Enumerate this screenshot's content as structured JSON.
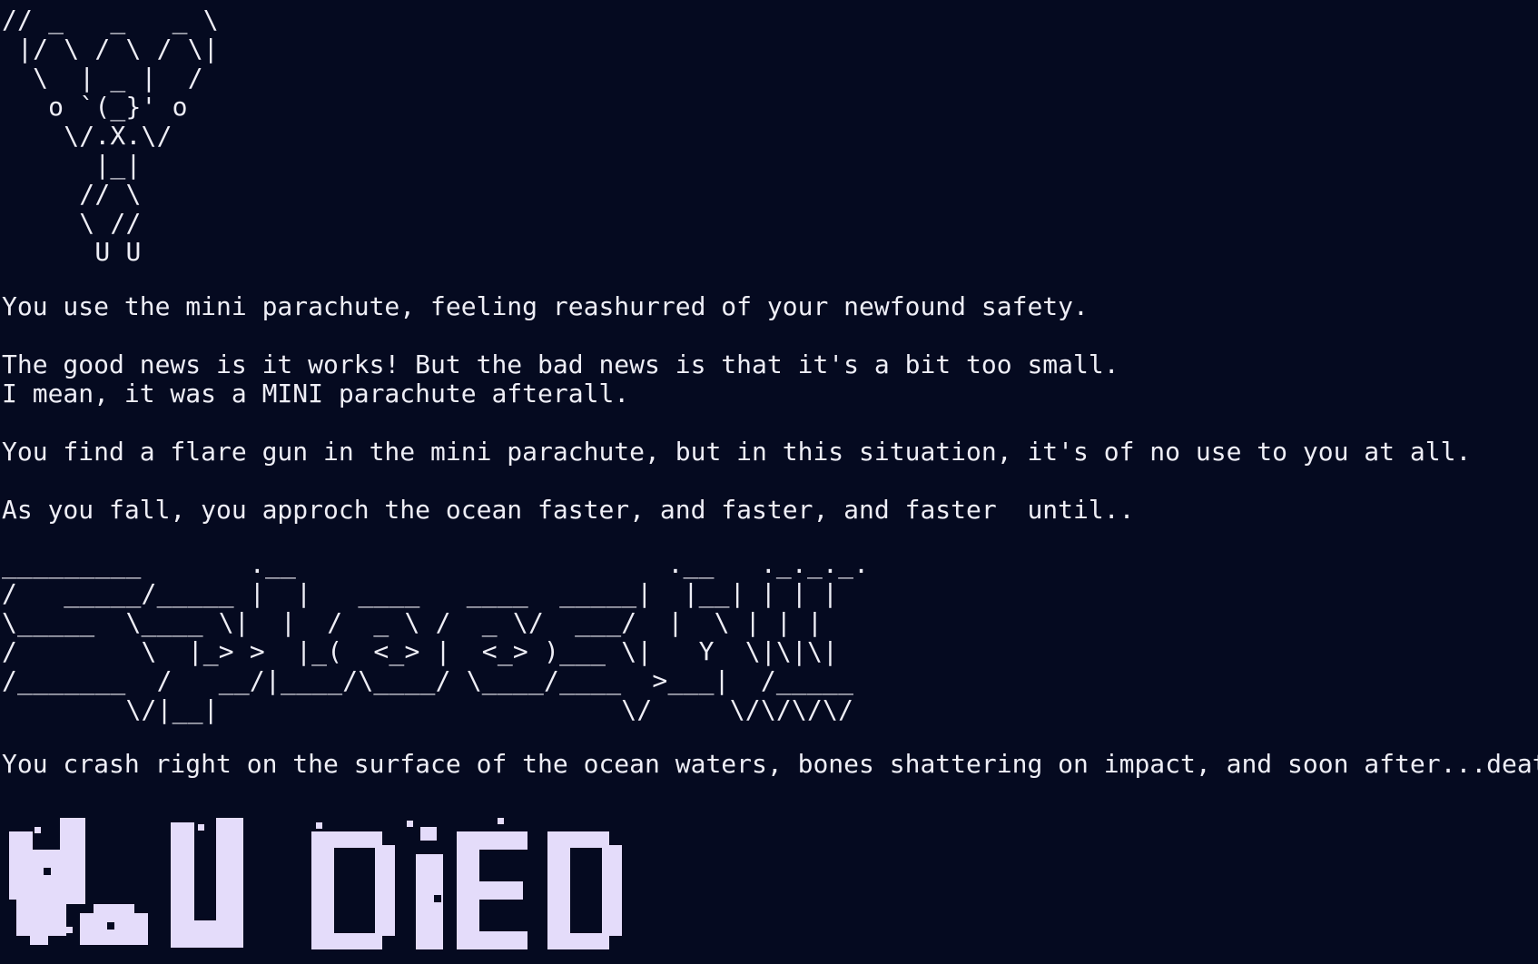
{
  "terminal": {
    "background": "#050a20",
    "foreground": "#eeeef6",
    "banner_color": "#e4dcfa",
    "deer_art": [
      "// _   _   _ \\",
      " |/ \\ / \\ / \\|",
      "  \\  | _ |  /",
      "   o `(_}' o",
      "    \\/.X.\\/",
      "      |_|",
      "     // \\",
      "     \\ //",
      "      U U"
    ],
    "story": [
      "You use the mini parachute, feeling reashurred of your newfound safety.",
      "",
      "The good news is it works! But the bad news is that it's a bit too small.",
      "I mean, it was a MINI parachute afterall.",
      "",
      "You find a flare gun in the mini parachute, but in this situation, it's of no use to you at all.",
      "",
      "As you fall, you approch the ocean faster, and faster, and faster  until.."
    ],
    "splash_art": [
      "_________       .__                        .__   ._._._.",
      "/   _____/_____ |  |   ____   ____  _____|  |__| | | |",
      "\\_____  \\____ \\|  |  /  _ \\ /  _ \\/  ___/  |  \\ | | |",
      "/        \\  |_> >  |_(  <_> |  <_> )___ \\|   Y  \\|\\|\\|",
      "/_______  /   __/|____/\\____/ \\____/____  >___|  /_____",
      "        \\/|__|                          \\/     \\/\\/\\/\\/"
    ],
    "ending": "You crash right on the surface of the ocean waters, bones shattering on impact, and soon after...death...",
    "died_banner": "YoU DiED"
  }
}
